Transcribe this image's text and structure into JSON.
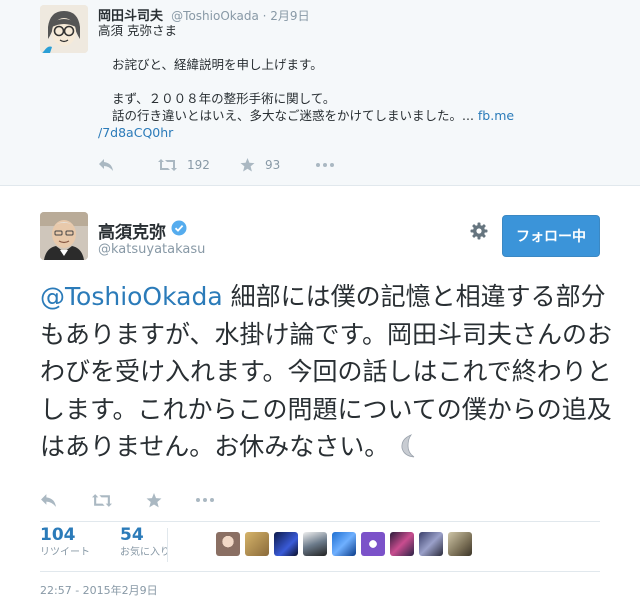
{
  "reply_tweet": {
    "name": "岡田斗司夫",
    "handle": "@ToshioOkada",
    "date": "2月9日",
    "lines": [
      "高須 克弥さま",
      "",
      "お詫びと、経緯説明を申し上げます。",
      "",
      "まず、２００８年の整形手術に関して。",
      "話の行き違いとはいえ、多大なご迷惑をかけてしまいました。..."
    ],
    "link_part1": "fb.me",
    "link_part2": "/7d8aCQ0hr",
    "retweet_count": "192",
    "favorite_count": "93"
  },
  "main_tweet": {
    "name": "高須克弥",
    "handle": "@katsuyatakasu",
    "follow_label": "フォロー中",
    "mention": "@ToshioOkada",
    "text": " 細部には僕の記憶と相違する部分もありますが、水掛け論です。岡田斗司夫さんのおわびを受け入れます。今回の話しはこれで終わりとします。これからこの問題についての僕からの追及はありません。お休みなさい。",
    "emoji": "🌙",
    "retweets_count": "104",
    "retweets_label": "リツイート",
    "favorites_count": "54",
    "favorites_label": "お気に入り",
    "timestamp": "22:57 - 2015年2月9日"
  },
  "colors": {
    "link": "#2b7bb9",
    "follow_button": "#3b94d9",
    "verified": "#55acee",
    "muted": "#8899a6"
  },
  "icons": [
    "reply-icon",
    "retweet-icon",
    "favorite-icon",
    "more-icon",
    "gear-icon",
    "verified-badge-icon",
    "twitter-bird-icon",
    "moon-emoji"
  ]
}
